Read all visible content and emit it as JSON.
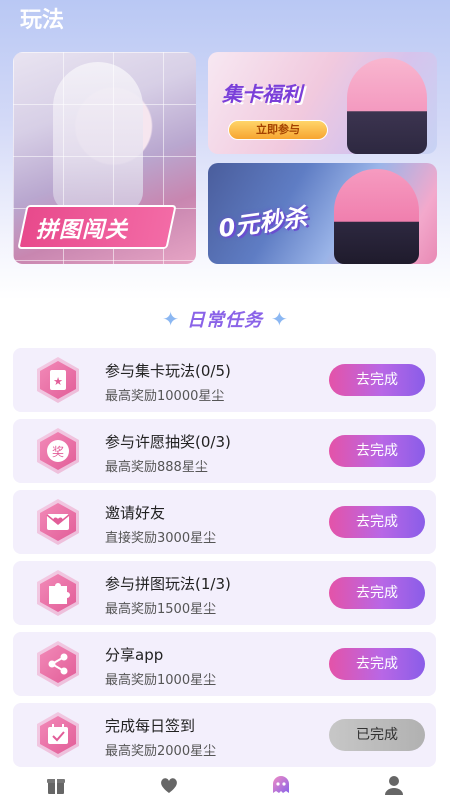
{
  "header": {
    "title": "玩法"
  },
  "banners": {
    "puzzle": {
      "label": "拼图闯关"
    },
    "cards": {
      "title": "集卡福利",
      "button": "立即参与"
    },
    "flash_sale": {
      "title": "0元秒杀"
    }
  },
  "section": {
    "title": "日常任务"
  },
  "tasks": [
    {
      "title": "参与集卡玩法(0/5)",
      "subtitle": "最高奖励10000星尘",
      "button": "去完成",
      "icon": "card-star-icon"
    },
    {
      "title": "参与许愿抽奖(0/3)",
      "subtitle": "最高奖励888星尘",
      "button": "去完成",
      "icon": "lottery-prize-icon"
    },
    {
      "title": "邀请好友",
      "subtitle": "直接奖励3000星尘",
      "button": "去完成",
      "icon": "invite-envelope-icon"
    },
    {
      "title": "参与拼图玩法(1/3)",
      "subtitle": "最高奖励1500星尘",
      "button": "去完成",
      "icon": "puzzle-piece-icon"
    },
    {
      "title": "分享app",
      "subtitle": "最高奖励1000星尘",
      "button": "去完成",
      "icon": "share-icon"
    },
    {
      "title": "完成每日签到",
      "subtitle": "最高奖励2000星尘",
      "button": "已完成",
      "icon": "calendar-check-icon"
    }
  ],
  "bottom_nav": [
    {
      "icon": "gift-icon",
      "active": false
    },
    {
      "icon": "heart-icon",
      "active": false
    },
    {
      "icon": "ghost-icon",
      "active": true
    },
    {
      "icon": "user-icon",
      "active": false
    }
  ],
  "colors": {
    "accent_purple": "#8a63e8",
    "button_gradient_start": "#e453a8",
    "button_gradient_end": "#8a5de8",
    "task_bg": "#f3effc",
    "done_button": "#b8b8b8"
  }
}
